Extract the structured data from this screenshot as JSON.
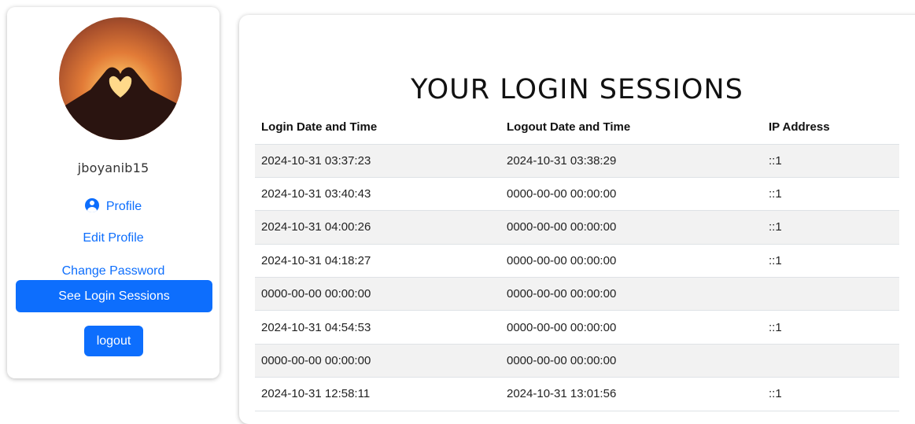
{
  "sidebar": {
    "username": "jboyanib15",
    "nav": {
      "profile": "Profile",
      "edit_profile": "Edit Profile",
      "change_password": "Change Password",
      "see_login_sessions": "See Login Sessions",
      "logout": "logout"
    }
  },
  "main": {
    "title": "YOUR LOGIN SESSIONS",
    "table": {
      "headers": [
        "Login Date and Time",
        "Logout Date and Time",
        "IP Address"
      ],
      "rows": [
        [
          "2024-10-31 03:37:23",
          "2024-10-31 03:38:29",
          "::1"
        ],
        [
          "2024-10-31 03:40:43",
          "0000-00-00 00:00:00",
          "::1"
        ],
        [
          "2024-10-31 04:00:26",
          "0000-00-00 00:00:00",
          "::1"
        ],
        [
          "2024-10-31 04:18:27",
          "0000-00-00 00:00:00",
          "::1"
        ],
        [
          "0000-00-00 00:00:00",
          "0000-00-00 00:00:00",
          ""
        ],
        [
          "2024-10-31 04:54:53",
          "0000-00-00 00:00:00",
          "::1"
        ],
        [
          "0000-00-00 00:00:00",
          "0000-00-00 00:00:00",
          ""
        ],
        [
          "2024-10-31 12:58:11",
          "2024-10-31 13:01:56",
          "::1"
        ]
      ]
    }
  },
  "colors": {
    "accent": "#0d6efd",
    "row_stripe": "#f2f2f2"
  },
  "icons": {
    "profile": "user-circle-icon"
  }
}
